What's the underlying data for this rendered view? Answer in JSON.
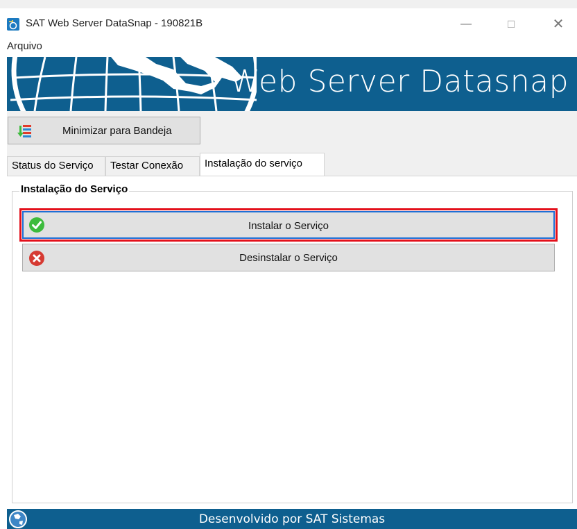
{
  "window": {
    "title": "SAT Web Server DataSnap - 190821B",
    "minimize_glyph": "—",
    "maximize_glyph": "☐",
    "close_glyph": "✕"
  },
  "menu": {
    "items": [
      {
        "label": "Arquivo"
      }
    ]
  },
  "banner": {
    "title": "Web Server Datasnap",
    "color": "#0e5f8f"
  },
  "toolbar": {
    "tray_button_label": "Minimizar para Bandeja",
    "tray_button_icon": "minimize-to-tray-icon"
  },
  "tabs": [
    {
      "label": "Status do Serviço",
      "active": false
    },
    {
      "label": "Testar Conexão",
      "active": false
    },
    {
      "label": "Instalação do serviço",
      "active": true
    }
  ],
  "panel": {
    "group_title": "Instalação do Serviço",
    "install_button": {
      "label": "Instalar o Serviço",
      "icon": "check-circle-icon",
      "icon_color": "#3dbb3d"
    },
    "uninstall_button": {
      "label": "Desinstalar o Serviço",
      "icon": "x-circle-icon",
      "icon_color": "#d63a32"
    }
  },
  "footer": {
    "text": "Desenvolvido por SAT Sistemas",
    "color": "#0e5f8f"
  }
}
